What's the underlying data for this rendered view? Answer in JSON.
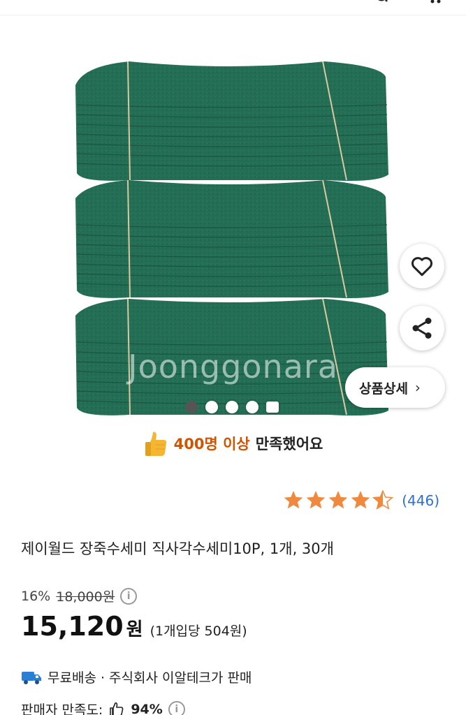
{
  "top_bar": {
    "icons": [
      "search-icon",
      "cart-icon"
    ]
  },
  "gallery": {
    "watermark": "Joonggonara",
    "image_count": 5,
    "active_index": 0,
    "detail_button_label": "상품상세",
    "detail_button_icon": "chevron-right-icon",
    "like_icon": "heart-outline-icon",
    "share_icon": "share-icon",
    "product_color": "#236e55"
  },
  "satisfaction": {
    "icon": "thumbs-up-icon",
    "highlight": "400명 이상",
    "rest": "만족했어요",
    "highlight_color": "#d35400"
  },
  "rating": {
    "stars": 4.5,
    "count_text": "(446)",
    "star_color": "#f0883e"
  },
  "product": {
    "title": "제이월드 장죽수세미 직사각수세미10P, 1개, 30개"
  },
  "price": {
    "discount": "16%",
    "original": "18,000원",
    "amount": "15,120",
    "currency": "원",
    "unit_price": "(1개입당 504원)"
  },
  "shipping": {
    "icon": "truck-icon",
    "text": "무료배송 · 주식회사 이알테크가 판매"
  },
  "seller": {
    "label": "판매자 만족도:",
    "icon": "thumbs-up-outline-icon",
    "percent": "94%"
  }
}
